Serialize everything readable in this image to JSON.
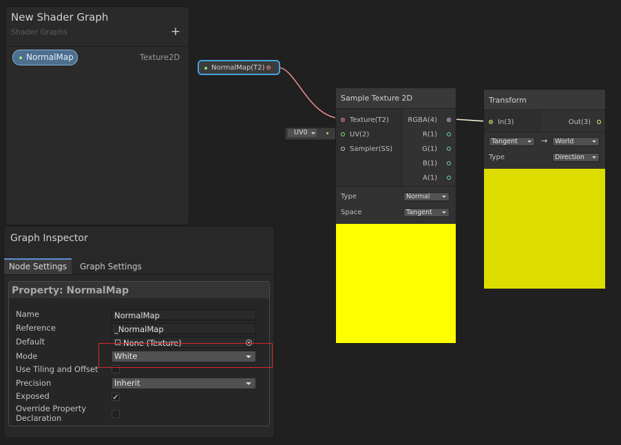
{
  "blackboard": {
    "title": "New Shader Graph",
    "subtitle": "Shader Graphs",
    "add_label": "+",
    "property": {
      "name": "NormalMap",
      "type": "Texture2D"
    }
  },
  "inspector": {
    "title": "Graph Inspector",
    "tabs": [
      {
        "label": "Node Settings"
      },
      {
        "label": "Graph Settings"
      }
    ],
    "property_title": "Property: NormalMap",
    "fields": {
      "name": {
        "label": "Name",
        "value": "NormalMap"
      },
      "reference": {
        "label": "Reference",
        "value": "_NormalMap"
      },
      "default": {
        "label": "Default",
        "value": "None (Texture)"
      },
      "mode": {
        "label": "Mode",
        "value": "White"
      },
      "tiling": {
        "label": "Use Tiling and Offset",
        "checked": false
      },
      "precision": {
        "label": "Precision",
        "value": "Inherit"
      },
      "exposed": {
        "label": "Exposed",
        "checked": true,
        "mark": "✓"
      },
      "override_line1": "Override Property",
      "override_line2": "Declaration"
    }
  },
  "graph": {
    "property_node": {
      "label": "NormalMap(T2)"
    },
    "uv_node": {
      "value": "UV0"
    },
    "sample_texture": {
      "title": "Sample Texture 2D",
      "inputs": [
        "Texture(T2)",
        "UV(2)",
        "Sampler(SS)"
      ],
      "outputs": [
        "RGBA(4)",
        "R(1)",
        "G(1)",
        "B(1)",
        "A(1)"
      ],
      "type_label": "Type",
      "type_value": "Normal",
      "space_label": "Space",
      "space_value": "Tangent",
      "preview_color": "#fefe00"
    },
    "transform": {
      "title": "Transform",
      "input": "In(3)",
      "output": "Out(3)",
      "from_space": "Tangent",
      "arrow": "→",
      "to_space": "World",
      "type_label": "Type",
      "type_value": "Direction",
      "preview_color": "#dddd00"
    }
  },
  "colors": {
    "highlight": "#d8282c",
    "selection": "#43a5e0",
    "texture_port": "#e88a8a",
    "vector4_port": "#f0b0f0",
    "vector2_port": "#8ee67a",
    "float_port": "#6ad8d0",
    "vector3_port": "#f2f27a"
  }
}
